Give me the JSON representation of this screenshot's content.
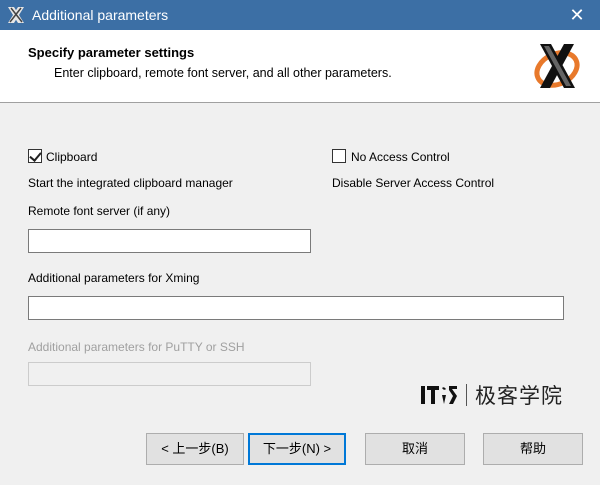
{
  "window": {
    "title": "Additional parameters",
    "close_glyph": "✕"
  },
  "header": {
    "title": "Specify parameter settings",
    "subtitle": "Enter clipboard, remote font server, and all other parameters."
  },
  "options": {
    "clipboard": {
      "label": "Clipboard",
      "checked": true,
      "description": "Start the integrated clipboard manager"
    },
    "no_access_control": {
      "label": "No Access Control",
      "checked": false,
      "description": "Disable Server Access Control"
    }
  },
  "fields": {
    "font_server": {
      "label": "Remote font server (if any)",
      "value": ""
    },
    "xming_params": {
      "label": "Additional parameters for Xming",
      "value": ""
    },
    "putty_params": {
      "label": "Additional parameters for PuTTY or SSH",
      "value": "",
      "disabled": true
    }
  },
  "watermark": {
    "text": "极客学院"
  },
  "buttons": {
    "back": "< 上一步(B)",
    "next": "下一步(N) >",
    "cancel": "取消",
    "help": "帮助"
  },
  "colors": {
    "titlebar": "#3c6fa5",
    "logo_orange": "#e8792b",
    "default_button_border": "#0078d7"
  },
  "icons": {
    "app": "xming-x-icon",
    "header_logo": "xming-logo-icon",
    "close": "close-icon"
  }
}
